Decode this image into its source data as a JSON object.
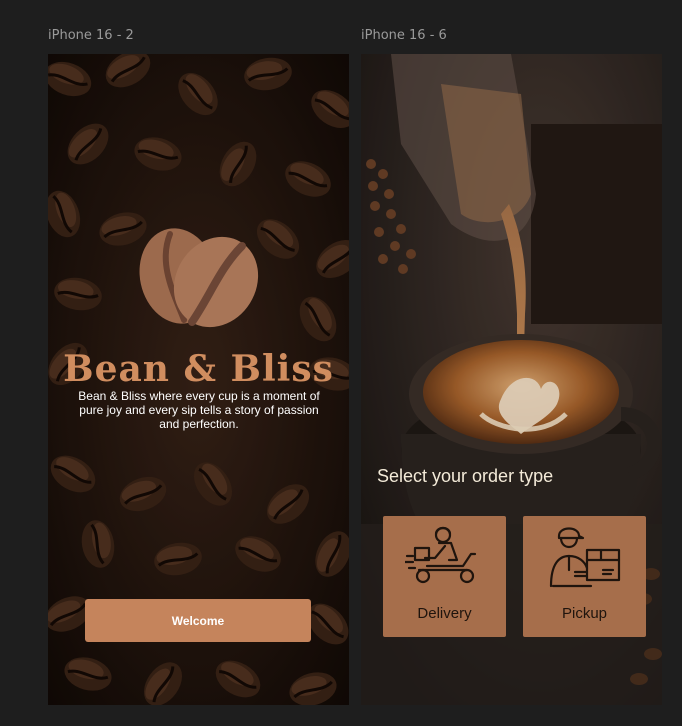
{
  "canvas": {
    "frames": [
      {
        "label": "iPhone 16 - 2"
      },
      {
        "label": "iPhone 16 - 6"
      }
    ]
  },
  "welcome_screen": {
    "brand": "Bean & Bliss",
    "tagline": "Bean & Bliss  where every cup is a moment of pure joy and every sip tells a story of passion and perfection.",
    "button_label": "Welcome"
  },
  "order_screen": {
    "title": "Select your order type",
    "options": [
      {
        "label": "Delivery",
        "icon": "delivery-scooter-icon"
      },
      {
        "label": "Pickup",
        "icon": "pickup-courier-icon"
      }
    ]
  },
  "colors": {
    "canvas_bg": "#1e1e1e",
    "brand": "#d08d5f",
    "button": "#c5845c",
    "option_card": "#a66e4b"
  }
}
